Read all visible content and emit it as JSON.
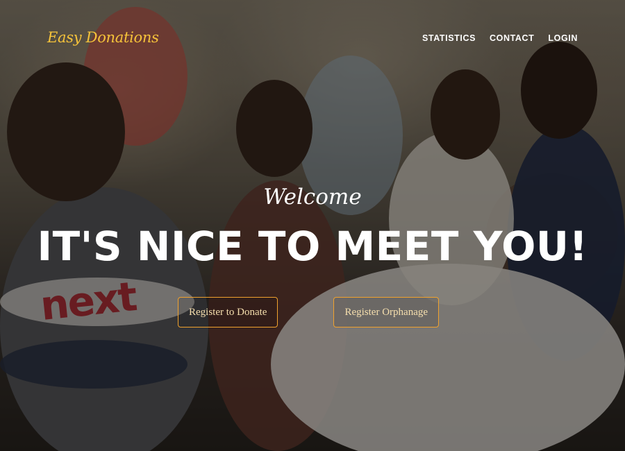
{
  "navbar": {
    "brand": "Easy Donations",
    "links": [
      {
        "label": "STATISTICS"
      },
      {
        "label": "CONTACT"
      },
      {
        "label": "LOGIN"
      }
    ]
  },
  "hero": {
    "subheading": "Welcome",
    "heading": "IT'S NICE TO MEET YOU!",
    "buttons": {
      "donate_label": "Register to Donate",
      "orphanage_label": "Register Orphanage"
    },
    "shirt_logo_text": "next"
  },
  "colors": {
    "brand": "#f6c33a",
    "button_border": "#f0a22e",
    "text": "#ffffff"
  }
}
